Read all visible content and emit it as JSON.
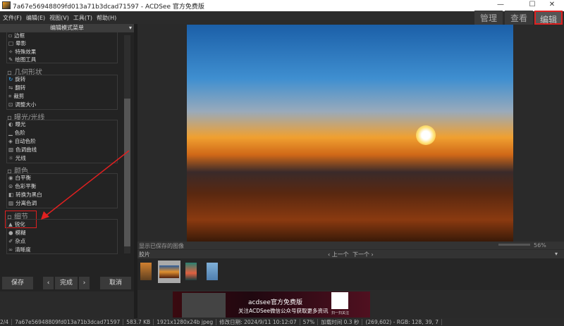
{
  "window": {
    "title": "7a67e56948809fd013a71b3dcad71597 - ACDSee 官方免费版",
    "minimize": "—",
    "maximize": "☐",
    "close": "✕"
  },
  "menu": [
    "文件(F)",
    "编辑(E)",
    "视图(V)",
    "工具(T)",
    "帮助(H)"
  ],
  "modes": [
    "管理",
    "查看",
    "编辑"
  ],
  "panel": {
    "title": "编辑模式菜单",
    "top_items": [
      "边框",
      "晕影",
      "特殊效果",
      "绘图工具"
    ],
    "groups": [
      {
        "title": "几何形状",
        "items": [
          "旋转",
          "翻转",
          "裁剪",
          "调整大小"
        ]
      },
      {
        "title": "曝光/光线",
        "items": [
          "曝光",
          "色阶",
          "自动色阶",
          "色调曲线",
          "光线"
        ]
      },
      {
        "title": "颜色",
        "items": [
          "白平衡",
          "色彩平衡",
          "转换为黑白",
          "分离色调"
        ]
      },
      {
        "title": "细节",
        "items": [
          "锐化",
          "模糊",
          "杂点",
          "清晰度"
        ]
      }
    ]
  },
  "buttons": {
    "save": "保存",
    "prev": "‹",
    "done": "完成",
    "next": "›",
    "cancel": "取消"
  },
  "infobar": {
    "show_saved": "显示已保存的图像",
    "zoom": "56%"
  },
  "filmstrip": {
    "title": "胶片",
    "prev": "‹ 上一个",
    "next": "下一个 ›"
  },
  "ad": {
    "brand": "acdsee官方免费版",
    "text": "关注ACDSee微信公众号获取更多资讯",
    "qr": "扫一扫关注"
  },
  "status": {
    "index": "2/4",
    "name": "7a67e56948809fd013a71b3dcad71597",
    "size": "583.7 KB",
    "dims": "1921x1280x24b jpeg",
    "modified": "修改日期: 2024/9/11 10:12:07",
    "zoom": "57%",
    "load": "加载时间 0.3 秒",
    "pixel": "(269,602) - RGB: 128, 39, 7"
  },
  "colors": {
    "highlight": "#e02020",
    "accent": "#f4a020"
  }
}
